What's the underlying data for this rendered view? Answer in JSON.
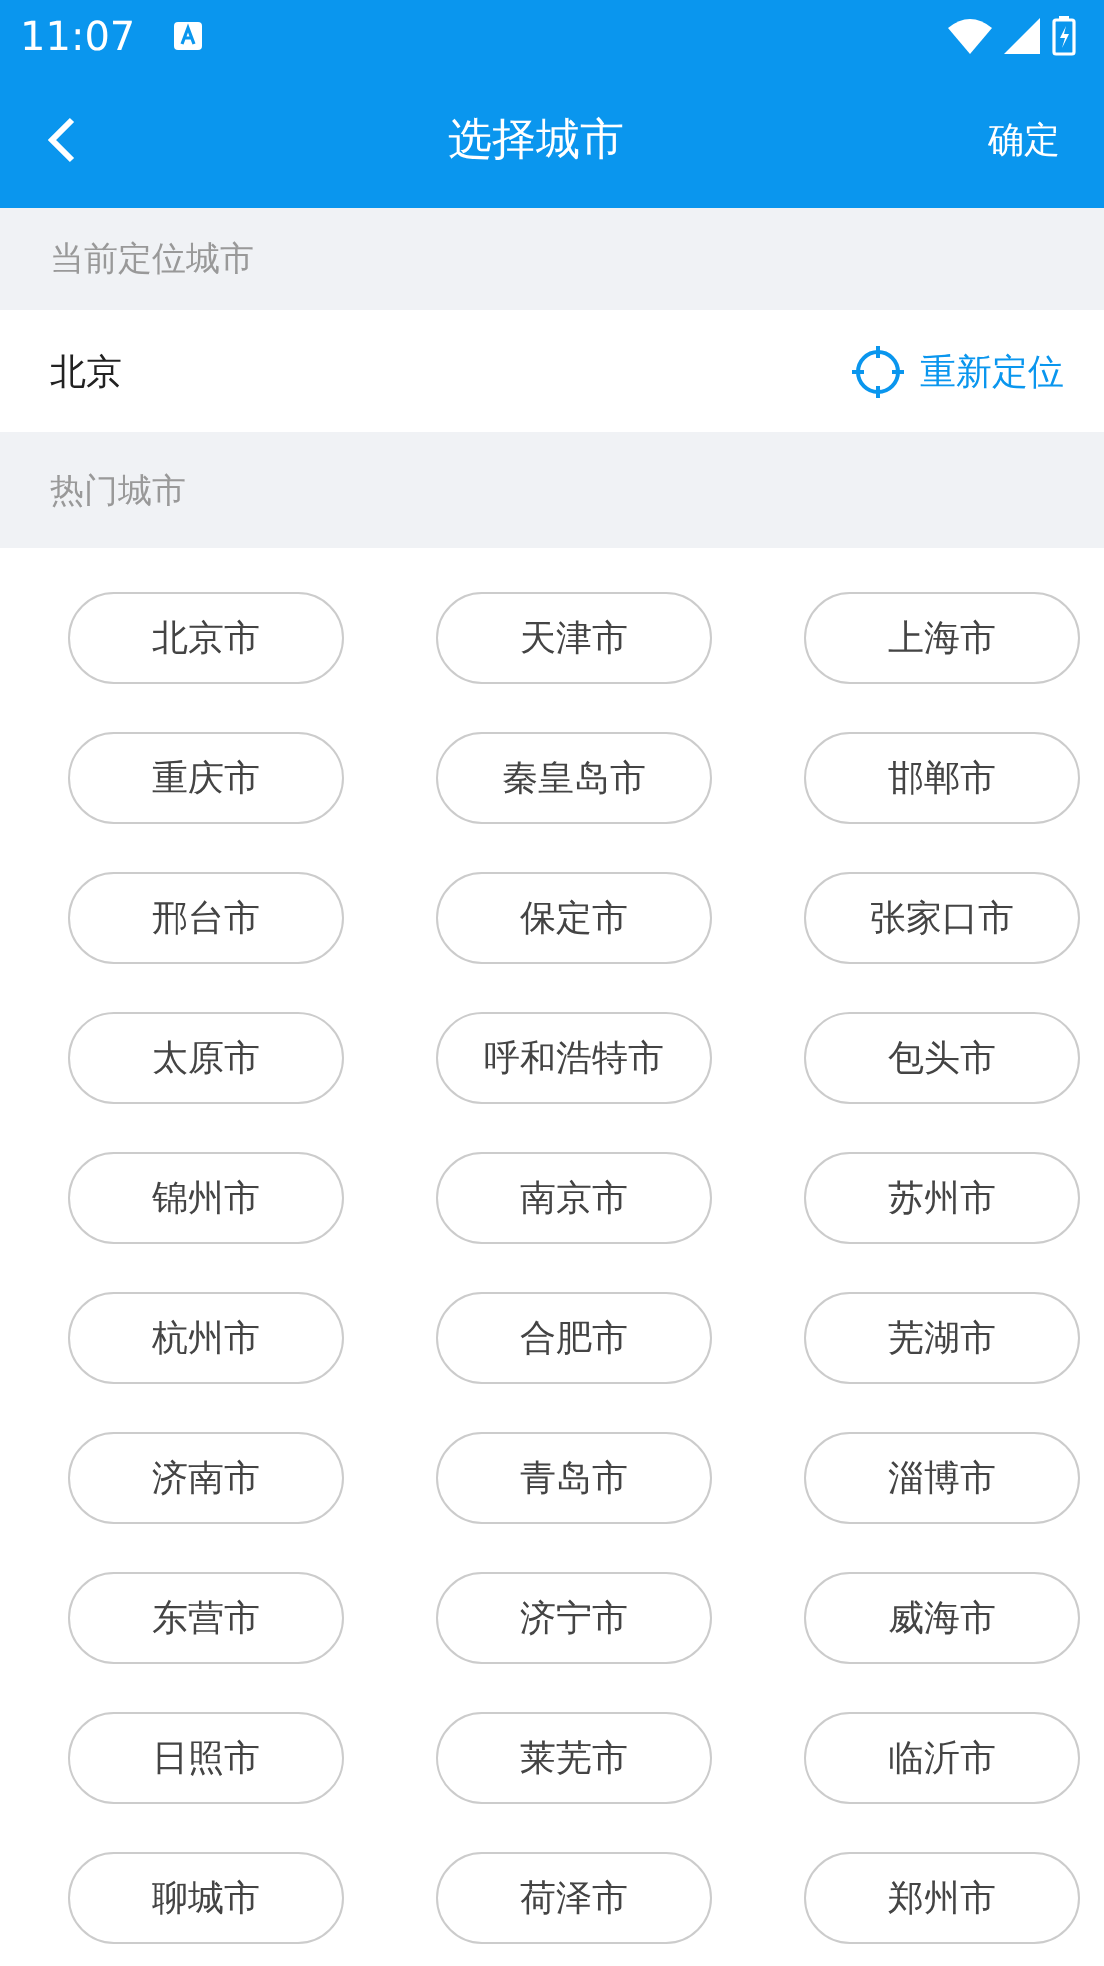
{
  "status_bar": {
    "time": "11:07"
  },
  "header": {
    "title": "选择城市",
    "confirm": "确定"
  },
  "current_section": {
    "title": "当前定位城市",
    "city": "北京",
    "relocate": "重新定位"
  },
  "hot_section": {
    "title": "热门城市"
  },
  "hot_cities": [
    "北京市",
    "天津市",
    "上海市",
    "重庆市",
    "秦皇岛市",
    "邯郸市",
    "邢台市",
    "保定市",
    "张家口市",
    "太原市",
    "呼和浩特市",
    "包头市",
    "锦州市",
    "南京市",
    "苏州市",
    "杭州市",
    "合肥市",
    "芜湖市",
    "济南市",
    "青岛市",
    "淄博市",
    "东营市",
    "济宁市",
    "威海市",
    "日照市",
    "莱芜市",
    "临沂市",
    "聊城市",
    "荷泽市",
    "郑州市"
  ]
}
